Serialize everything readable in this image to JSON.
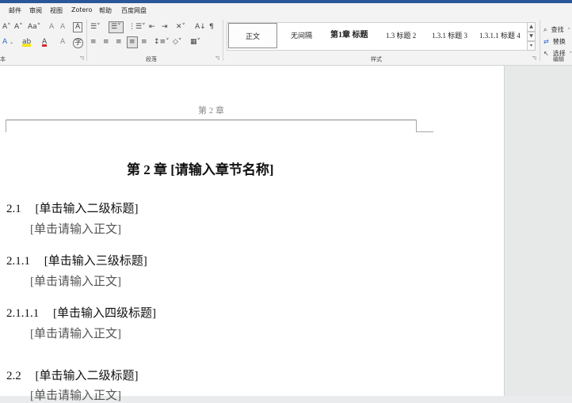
{
  "menu": [
    "邮件",
    "审阅",
    "视图",
    "Zotero",
    "帮助",
    "百度网盘"
  ],
  "ribbon": {
    "font_group_label": "本",
    "paragraph_group_label": "段落",
    "styles_group_label": "样式",
    "editing_group_label": "编辑",
    "font_icons_row1": [
      "A˄",
      "A˅",
      "Aa˅",
      "A",
      "A"
    ],
    "font_icons_row2": [
      "A",
      "ab",
      "A",
      "A",
      "⊕"
    ],
    "para_icons_row1": [
      "≡",
      "≡",
      "≡",
      "⇤",
      "⇥",
      "✕",
      "ƶ"
    ],
    "para_icons_row2": [
      "≡",
      "≡",
      "≡",
      "≡",
      "≡",
      "≡",
      "◇",
      "▦"
    ],
    "styles": [
      "正文",
      "无间隔",
      "第1章  标题",
      "1.3  标题 2",
      "1.3.1  标题 3",
      "1.3.1.1  标题 4"
    ],
    "editing": {
      "find": "查找",
      "replace": "替换",
      "select": "选择"
    }
  },
  "document": {
    "header": "第 2 章",
    "heading1": "第 2 章     [请输入章节名称]",
    "blocks": [
      {
        "num": "2.1",
        "title": "[单击输入二级标题]",
        "body": "[单击请输入正文]"
      },
      {
        "num": "2.1.1",
        "title": "[单击输入三级标题]",
        "body": "[单击请输入正文]"
      },
      {
        "num": "2.1.1.1",
        "title": "[单击输入四级标题]",
        "body": "[单击请输入正文]"
      },
      {
        "num": "2.2",
        "title": "[单击输入二级标题]",
        "body": "[单击请输入正文]"
      }
    ]
  }
}
